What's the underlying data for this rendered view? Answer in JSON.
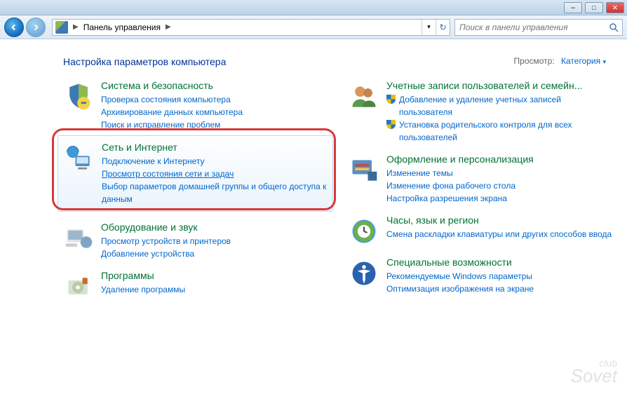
{
  "window": {
    "minimize": "–",
    "maximize": "□",
    "close": "×"
  },
  "nav": {
    "crumb_root": "Панель управления",
    "crumb_sep": "▶",
    "refresh": "↻",
    "dropdown": "▾"
  },
  "search": {
    "placeholder": "Поиск в панели управления"
  },
  "heading": "Настройка параметров компьютера",
  "view": {
    "label": "Просмотр:",
    "value": "Категория",
    "arrow": "▾"
  },
  "left": {
    "security": {
      "title": "Система и безопасность",
      "l1": "Проверка состояния компьютера",
      "l2": "Архивирование данных компьютера",
      "l3": "Поиск и исправление проблем"
    },
    "network": {
      "title": "Сеть и Интернет",
      "l1": "Подключение к Интернету",
      "l2": "Просмотр состояния сети и задач",
      "l3": "Выбор параметров домашней группы и общего доступа к данным"
    },
    "hardware": {
      "title": "Оборудование и звук",
      "l1": "Просмотр устройств и принтеров",
      "l2": "Добавление устройства"
    },
    "programs": {
      "title": "Программы",
      "l1": "Удаление программы"
    }
  },
  "right": {
    "users": {
      "title": "Учетные записи пользователей и семейн...",
      "l1": "Добавление и удаление учетных записей пользователя",
      "l2": "Установка родительского контроля для всех пользователей"
    },
    "appearance": {
      "title": "Оформление и персонализация",
      "l1": "Изменение темы",
      "l2": "Изменение фона рабочего стола",
      "l3": "Настройка разрешения экрана"
    },
    "clock": {
      "title": "Часы, язык и регион",
      "l1": "Смена раскладки клавиатуры или других способов ввода"
    },
    "access": {
      "title": "Специальные возможности",
      "l1": "Рекомендуемые Windows параметры",
      "l2": "Оптимизация изображения на экране"
    }
  },
  "watermark": {
    "top": "club",
    "bottom": "Sovet"
  }
}
